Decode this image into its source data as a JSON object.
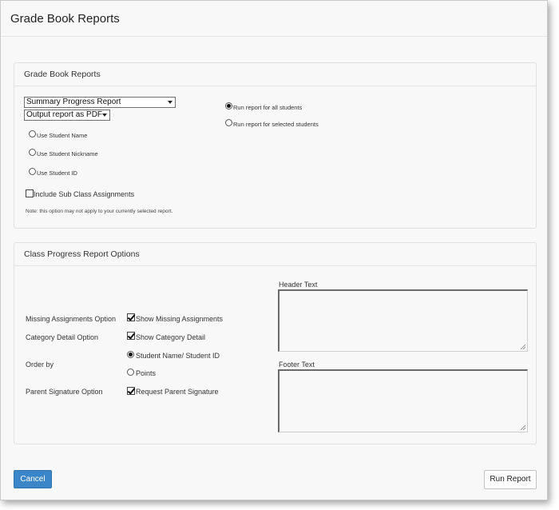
{
  "dialog": {
    "title": "Grade Book Reports"
  },
  "report_panel": {
    "heading": "Grade Book Reports",
    "report_select": {
      "value": "Summary Progress Report"
    },
    "output_select": {
      "value": "Output report as PDF"
    },
    "name_options": [
      {
        "label": "Use Student Name",
        "checked": false
      },
      {
        "label": "Use Student Nickname",
        "checked": false
      },
      {
        "label": "Use Student ID",
        "checked": false
      }
    ],
    "student_scope": [
      {
        "label": "Run report for all students",
        "checked": true
      },
      {
        "label": "Run report for selected students",
        "checked": false
      }
    ],
    "include_sub_class": {
      "label": "Include Sub Class Assignments",
      "checked": false
    },
    "note": "Note: this option may not apply to your currently selected report."
  },
  "options_panel": {
    "heading": "Class Progress Report Options",
    "missing_assignments": {
      "option_label": "Missing Assignments Option",
      "label": "Show Missing Assignments",
      "checked": true
    },
    "category_detail": {
      "option_label": "Category Detail Option",
      "label": "Show Category Detail",
      "checked": true
    },
    "order_by": {
      "option_label": "Order by",
      "choices": [
        {
          "label": "Student Name/ Student ID",
          "checked": true
        },
        {
          "label": "Points",
          "checked": false
        }
      ]
    },
    "parent_signature": {
      "option_label": "Parent Signature Option",
      "label": "Request Parent Signature",
      "checked": true
    },
    "header_text": {
      "label": "Header Text",
      "value": ""
    },
    "footer_text": {
      "label": "Footer Text",
      "value": ""
    }
  },
  "footer": {
    "cancel_label": "Cancel",
    "run_label": "Run Report"
  },
  "colors": {
    "primary_button": "#3a86c8",
    "panel_background": "#f7f8f7"
  }
}
